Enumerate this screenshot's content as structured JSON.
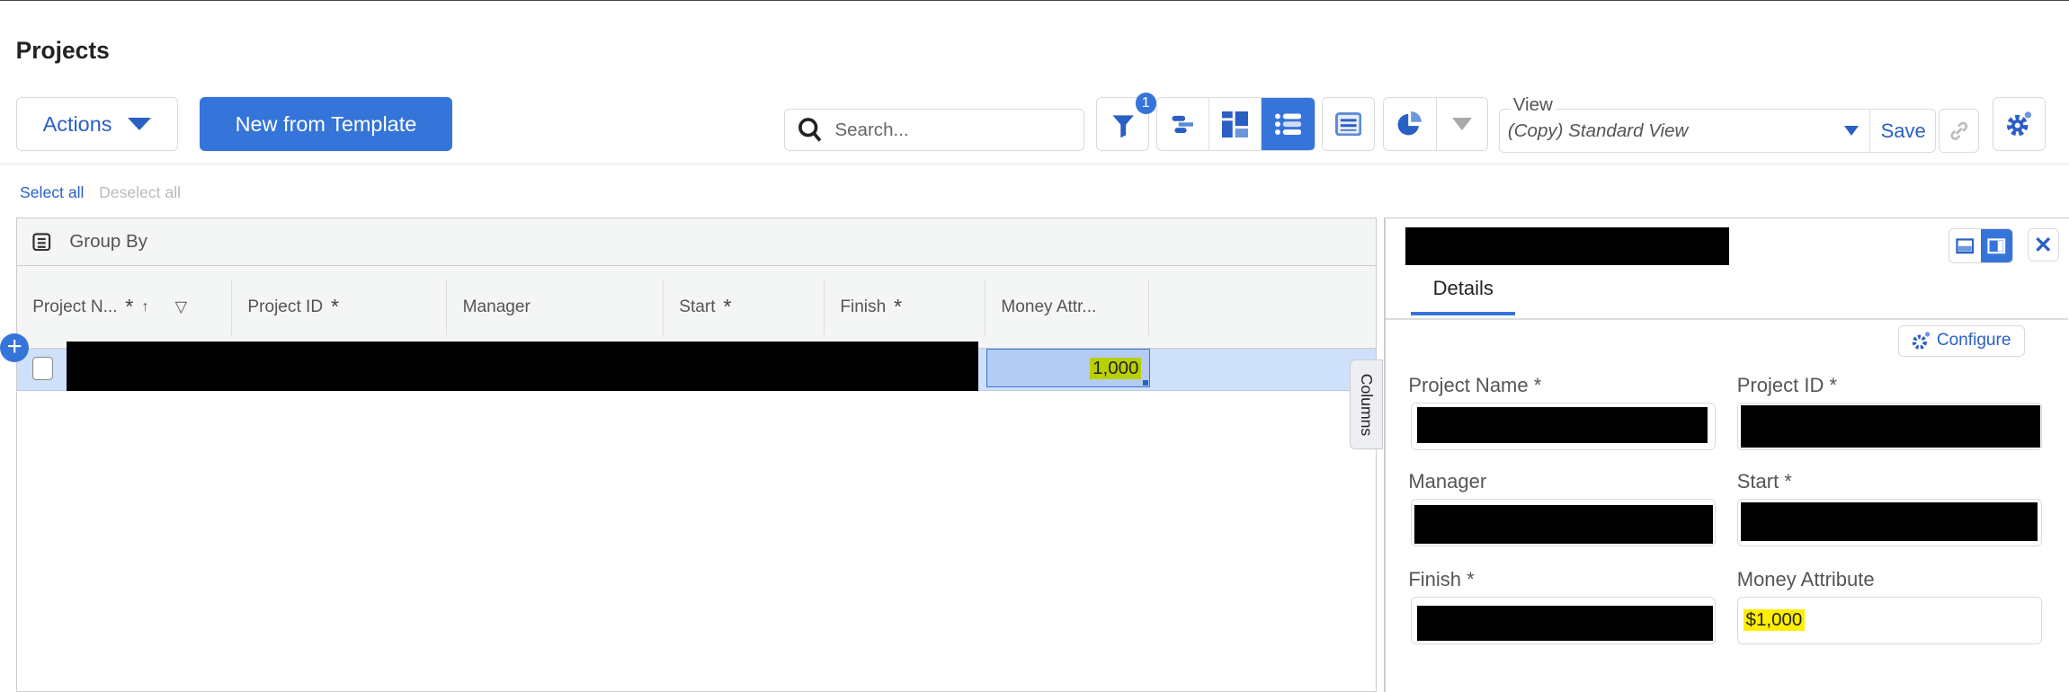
{
  "page_title": "Projects",
  "toolbar": {
    "actions_label": "Actions",
    "new_template_label": "New from Template",
    "search_placeholder": "Search...",
    "filter_badge": "1",
    "view_label": "View",
    "view_value": "(Copy) Standard View",
    "save_label": "Save"
  },
  "selection": {
    "select_all": "Select all",
    "deselect_all": "Deselect all"
  },
  "grid": {
    "group_by": "Group By",
    "columns": [
      "Project N...",
      "Project ID",
      "Manager",
      "Start",
      "Finish",
      "Money Attr..."
    ],
    "row": {
      "money": "1,000"
    },
    "columns_tab": "Columns"
  },
  "details": {
    "tab": "Details",
    "configure": "Configure",
    "fields": {
      "project_name": "Project Name",
      "project_id": "Project ID",
      "manager": "Manager",
      "start": "Start",
      "finish": "Finish",
      "money": "Money Attribute",
      "money_value": "$1,000"
    },
    "required_mark": "*"
  },
  "colors": {
    "accent": "#3574d9",
    "highlight": "#ffee00"
  }
}
